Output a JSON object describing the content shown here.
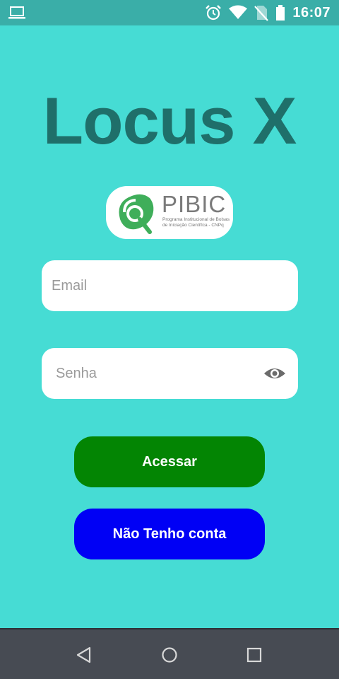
{
  "status_bar": {
    "time": "16:07",
    "icons": [
      "laptop-icon",
      "alarm-icon",
      "wifi-icon",
      "no-sim-icon",
      "battery-icon"
    ]
  },
  "app": {
    "title": "Locus X"
  },
  "logo": {
    "name": "PIBIC",
    "subtitle": "Programa Institucional de Bolsas de Iniciação Científica - CNPq"
  },
  "form": {
    "email_placeholder": "Email",
    "password_placeholder": "Senha",
    "login_label": "Acessar",
    "signup_label": "Não Tenho conta"
  },
  "nav_bar": {
    "icons": [
      "back-icon",
      "home-icon",
      "recents-icon"
    ]
  },
  "colors": {
    "background": "#46dcd4",
    "title": "#1f6f6a",
    "login_button": "#038503",
    "signup_button": "#0000f5",
    "nav_bar": "#474b53"
  }
}
